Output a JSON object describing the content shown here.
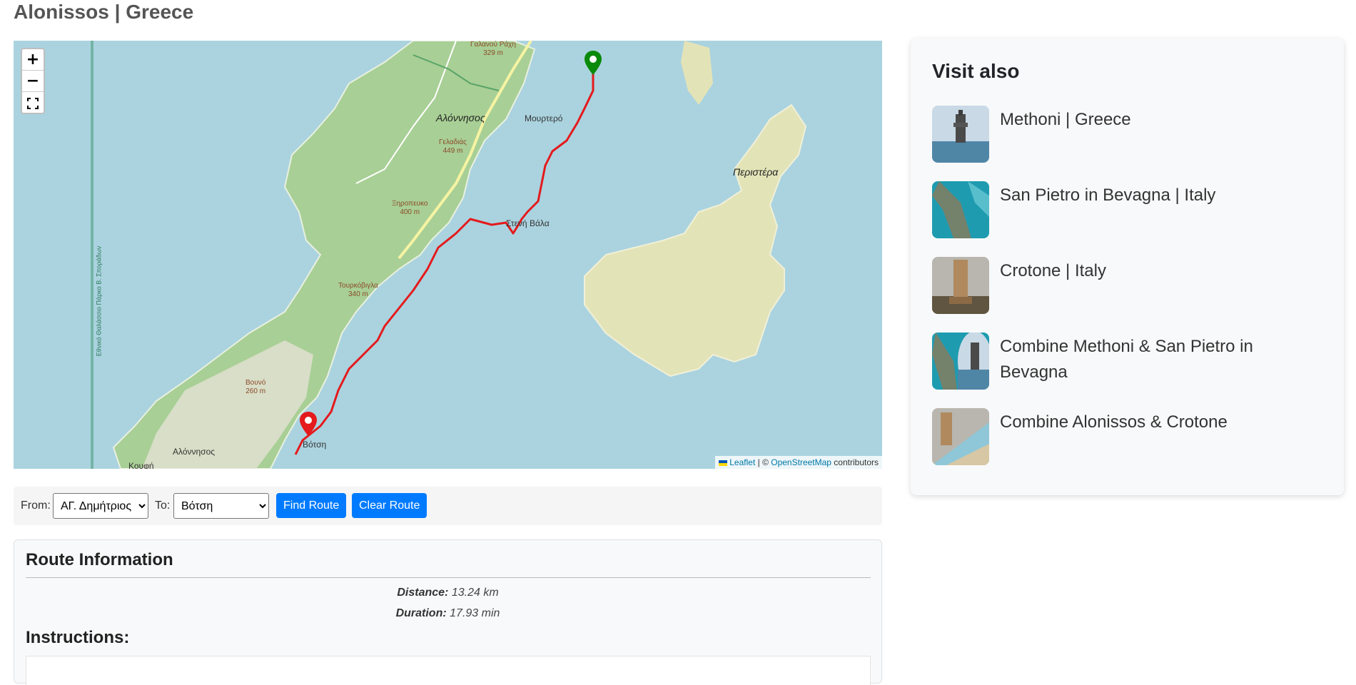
{
  "page": {
    "title": "Alonissos | Greece"
  },
  "map": {
    "zoom_in": "+",
    "zoom_out": "−",
    "fullscreen_icon": "fullscreen-icon",
    "attribution": {
      "leaflet": "Leaflet",
      "separator": " | © ",
      "osm": "OpenStreetMap",
      "suffix": " contributors"
    },
    "labels": {
      "alonnisos_town": "Αλόννησος",
      "mourtero": "Μουρτερό",
      "peristera": "Περιστέρα",
      "steni_vala": "Στενή Βάλα",
      "votsi": "Βότση",
      "alonnisos_south": "Αλόννησος",
      "koufi": "Κουφή",
      "galanou": "Γαλανού Ράχη",
      "galanou_alt": "329 m",
      "geladias": "Γελαδιάς",
      "geladias_alt": "449 m",
      "xiropefko": "Ξηροπευκο",
      "xiropefko_alt": "400 m",
      "tourkovigla": "Τουρκόβιγλα",
      "tourkovigla_alt": "340 m",
      "vouno": "Βουνό",
      "vouno_alt": "260 m",
      "marine_park": "Εθνικό Θαλάσσιο Πάρκο Β. Σποράδων"
    },
    "start_marker_color": "#0a8a0a",
    "end_marker_color": "#e41a1c",
    "route_color": "#e41a1c"
  },
  "route_form": {
    "from_label": "From:",
    "from_value": "ΑΓ. Δημήτριος",
    "to_label": "To:",
    "to_value": "Βότση",
    "find_button": "Find Route",
    "clear_button": "Clear Route"
  },
  "route_info": {
    "title": "Route Information",
    "distance_label": "Distance:",
    "distance_value": "13.24 km",
    "duration_label": "Duration:",
    "duration_value": "17.93 min",
    "instructions_title": "Instructions:"
  },
  "sidebar": {
    "title": "Visit also",
    "items": [
      {
        "label": "Methoni | Greece"
      },
      {
        "label": "San Pietro in Bevagna | Italy"
      },
      {
        "label": "Crotone | Italy"
      },
      {
        "label": "Combine Methoni & San Pietro in Bevagna"
      },
      {
        "label": "Combine Alonissos & Crotone"
      }
    ]
  },
  "colors": {
    "accent": "#007bff",
    "sea": "#aad3df",
    "land": "#a8cf95",
    "island": "#e3e3b8"
  }
}
